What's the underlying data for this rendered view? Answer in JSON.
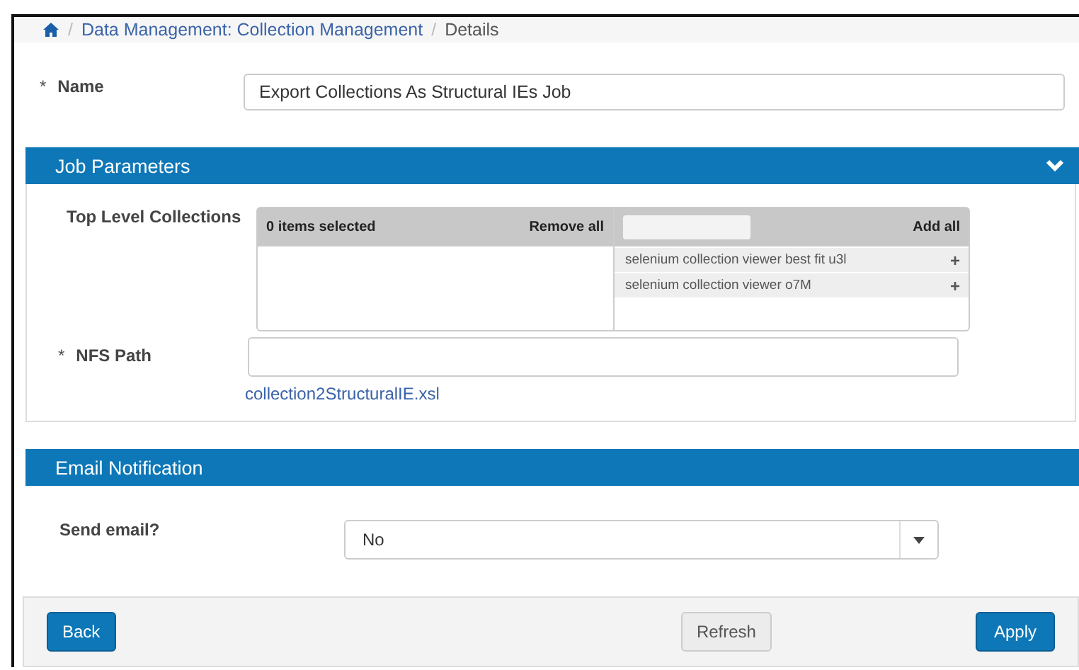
{
  "breadcrumb": {
    "items": [
      "Data Management: Collection Management"
    ],
    "current": "Details",
    "separator": "/"
  },
  "name_field": {
    "marker": "*",
    "label": "Name",
    "value": "Export Collections As Structural IEs Job"
  },
  "sections": [
    {
      "title": "Job Parameters",
      "collapsible": true
    },
    {
      "title": "Email Notification",
      "collapsible": false
    }
  ],
  "collections": {
    "label": "Top Level Collections",
    "selected_count": "0 items selected",
    "remove_all": "Remove all",
    "add_all": "Add all",
    "available": [
      {
        "name": "selenium collection viewer best fit u3l",
        "add": "+"
      },
      {
        "name": "selenium collection viewer o7M",
        "add": "+"
      }
    ]
  },
  "nfs_path": {
    "marker": "*",
    "label": "NFS Path",
    "link": "collection2StructuralIE.xsl"
  },
  "send_email": {
    "label": "Send email?",
    "value": "No"
  },
  "buttons": [
    {
      "label": "Back",
      "kind": "primary"
    },
    {
      "label": "Refresh",
      "kind": "secondary"
    },
    {
      "label": "Apply",
      "kind": "primary"
    }
  ]
}
